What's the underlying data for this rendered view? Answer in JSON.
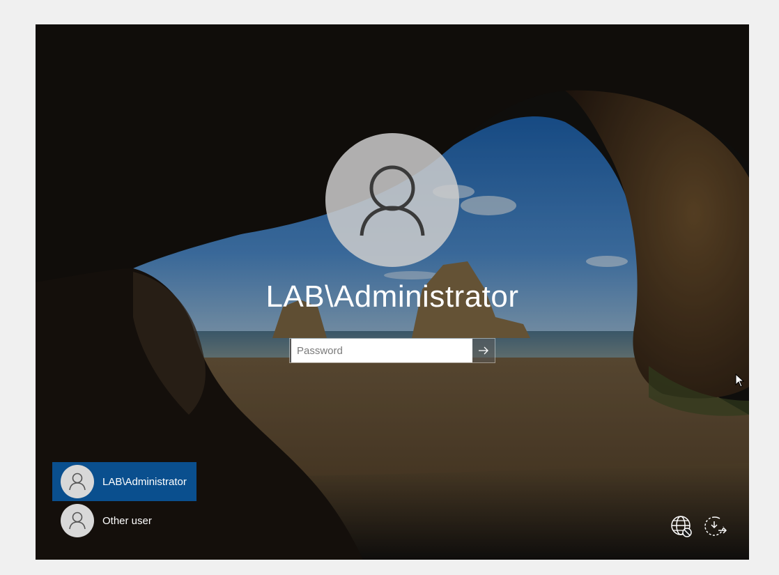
{
  "login": {
    "username": "LAB\\Administrator",
    "password_placeholder": "Password",
    "password_value": ""
  },
  "users": [
    {
      "name": "LAB\\Administrator",
      "selected": true
    },
    {
      "name": "Other user",
      "selected": false
    }
  ],
  "system_icons": [
    "network-icon",
    "ease-of-access-icon"
  ],
  "colors": {
    "selected_user_bg": "#0a4f8e",
    "avatar_bg": "#cdcdcd",
    "text": "#ffffff"
  }
}
